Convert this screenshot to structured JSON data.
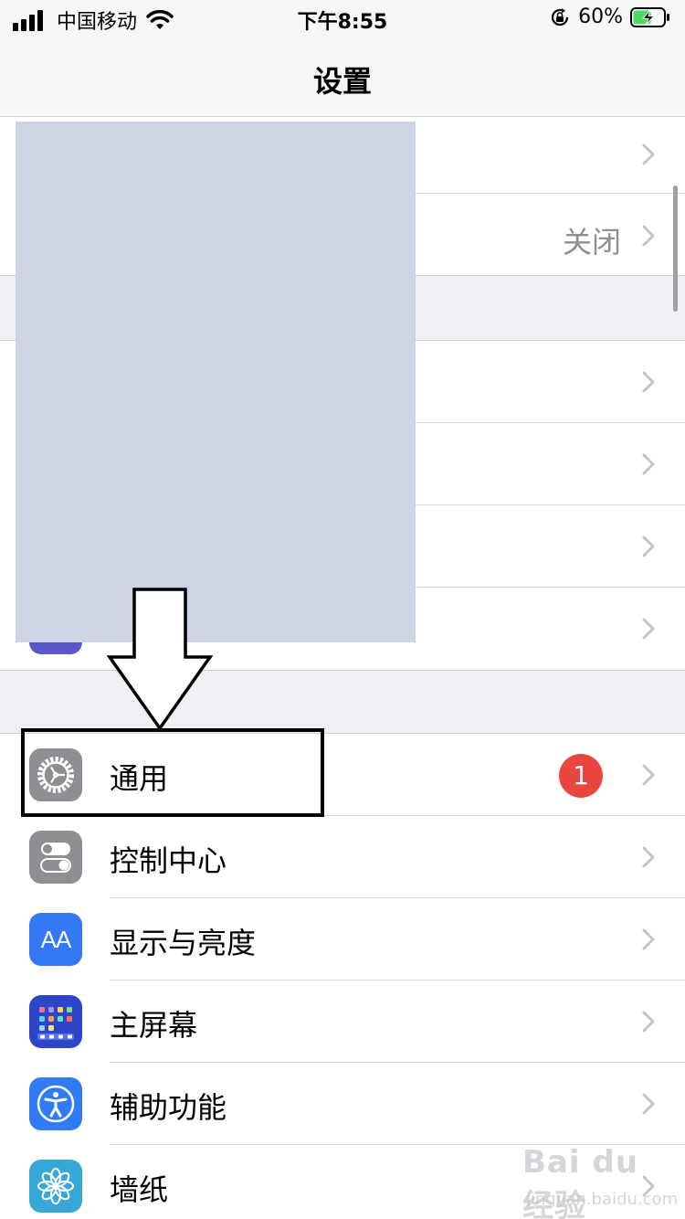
{
  "status_bar": {
    "carrier": "中国移动",
    "time": "下午8:55",
    "battery_percent": "60%",
    "battery_level": 0.6,
    "icons": [
      "signal-icon",
      "wifi-icon",
      "orientation-lock-icon",
      "battery-charging-icon"
    ]
  },
  "nav": {
    "title": "设置"
  },
  "group1": {
    "row2_value": "关闭"
  },
  "group3": {
    "rows": [
      {
        "label": "通用",
        "icon": "gear-icon",
        "icon_color": "#8e8e93",
        "badge": "1"
      },
      {
        "label": "控制中心",
        "icon": "toggle-switches-icon",
        "icon_color": "#8e8e93"
      },
      {
        "label": "显示与亮度",
        "icon": "text-size-icon",
        "icon_color": "#3478f6",
        "icon_text": "AA"
      },
      {
        "label": "主屏幕",
        "icon": "home-screen-grid-icon",
        "icon_color": "#2c45c9"
      },
      {
        "label": "辅助功能",
        "icon": "accessibility-icon",
        "icon_color": "#2f7cf6"
      },
      {
        "label": "墙纸",
        "icon": "flower-icon",
        "icon_color": "#36a7d6"
      }
    ]
  },
  "watermark": {
    "brand": "Bai du 经验",
    "site": "jingyan.baidu.com"
  },
  "colors": {
    "badge": "#e94640",
    "redaction": "#cdd5e4",
    "chevron": "#c4c4c7"
  }
}
